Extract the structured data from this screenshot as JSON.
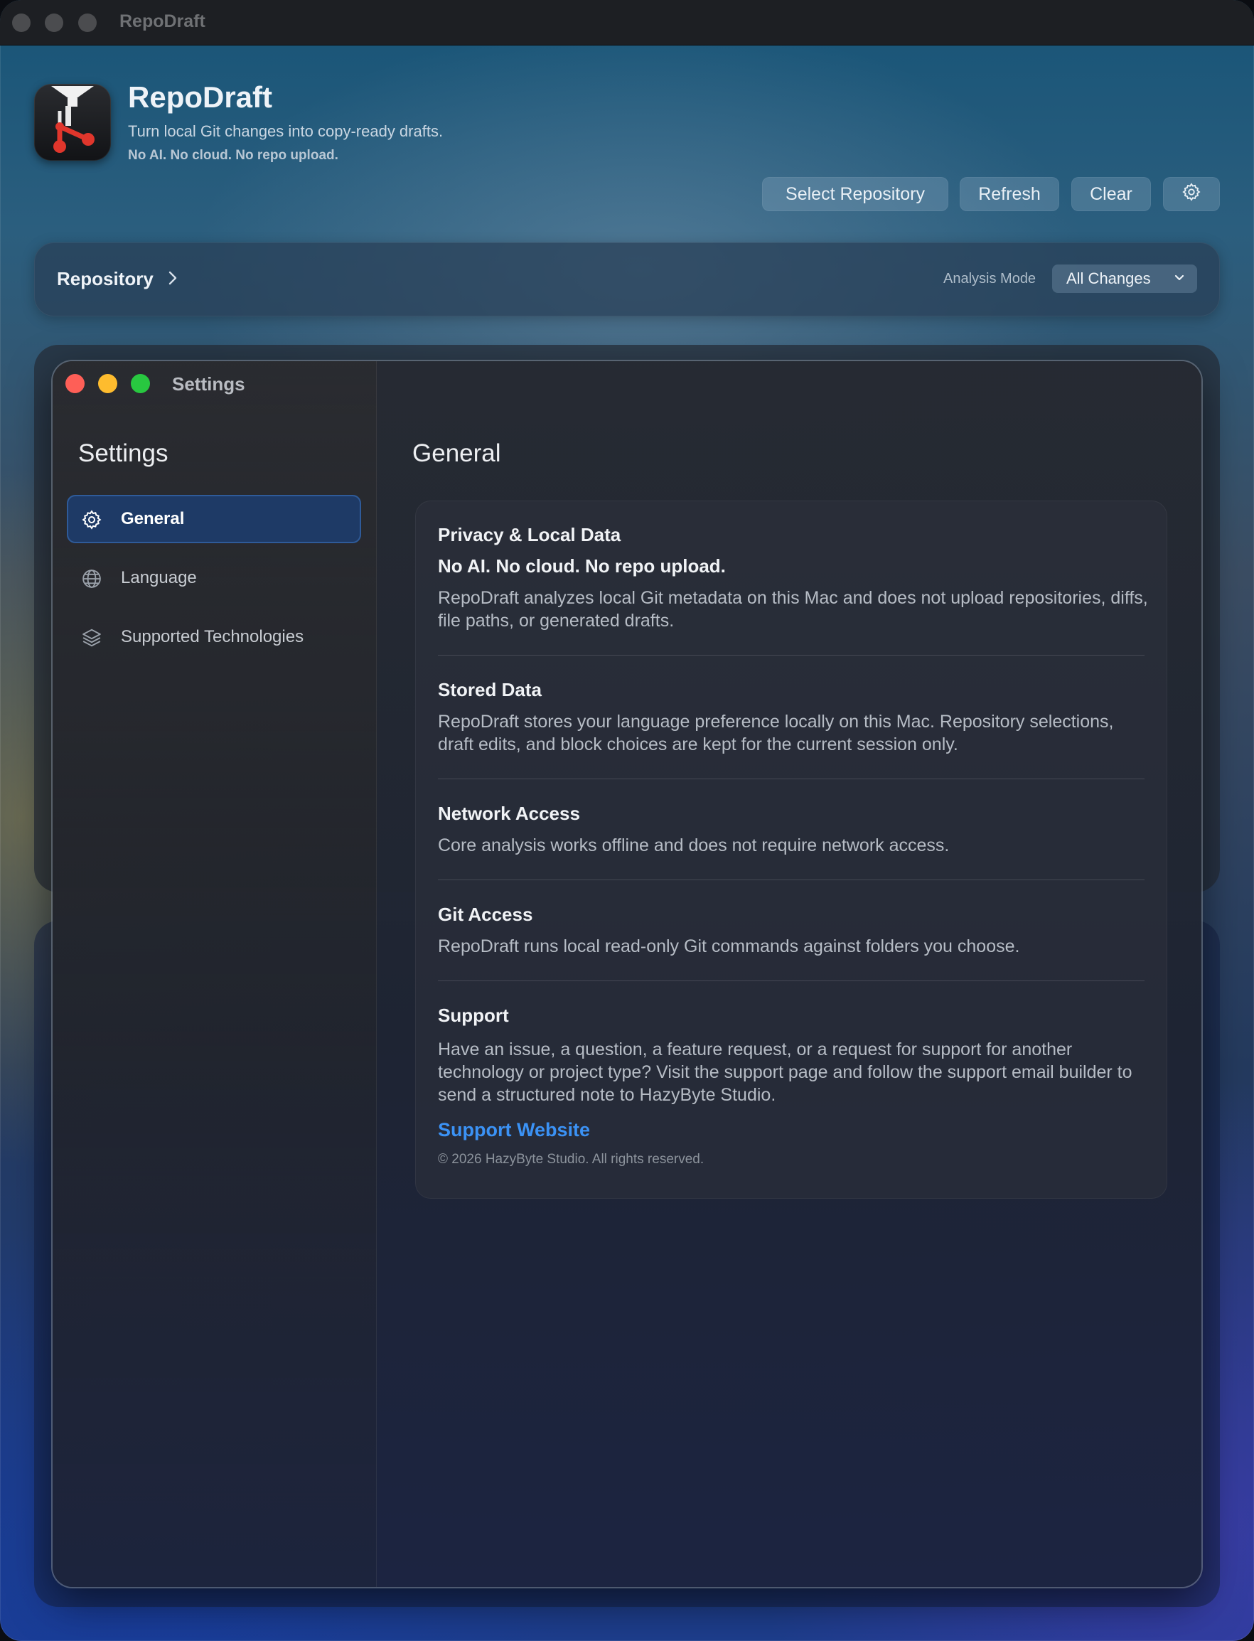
{
  "window": {
    "title": "RepoDraft"
  },
  "header": {
    "app_name": "RepoDraft",
    "subtitle": "Turn local Git changes into copy-ready drafts.",
    "tagline": "No AI. No cloud. No repo upload.",
    "icon": "app-logo-icon"
  },
  "toolbar": {
    "select_repository": "Select Repository",
    "refresh": "Refresh",
    "clear": "Clear",
    "settings_icon": "gear-icon"
  },
  "repository_bar": {
    "label": "Repository",
    "analysis_mode_label": "Analysis Mode",
    "analysis_mode_value": "All Changes"
  },
  "settings": {
    "window_title": "Settings",
    "sidebar_heading": "Settings",
    "sidebar_items": [
      {
        "label": "General",
        "icon": "gear-icon",
        "selected": true
      },
      {
        "label": "Language",
        "icon": "globe-icon",
        "selected": false
      },
      {
        "label": "Supported Technologies",
        "icon": "layers-icon",
        "selected": false
      }
    ],
    "content_heading": "General",
    "sections": {
      "privacy": {
        "title": "Privacy & Local Data",
        "emphasis": "No AI. No cloud. No repo upload.",
        "body": "RepoDraft analyzes local Git metadata on this Mac and does not upload repositories, diffs, file paths, or generated drafts."
      },
      "stored": {
        "title": "Stored Data",
        "body": "RepoDraft stores your language preference locally on this Mac. Repository selections, draft edits, and block choices are kept for the current session only."
      },
      "network": {
        "title": "Network Access",
        "body": "Core analysis works offline and does not require network access."
      },
      "git": {
        "title": "Git Access",
        "body": "RepoDraft runs local read-only Git commands against folders you choose."
      },
      "support": {
        "title": "Support",
        "body": "Have an issue, a question, a feature request, or a request for support for another technology or project type? Visit the support page and follow the support email builder to send a structured note to HazyByte Studio.",
        "link": "Support Website",
        "copyright": "© 2026 HazyByte Studio. All rights reserved."
      }
    }
  },
  "colors": {
    "accent_link": "#3b92f5",
    "selected_item_bg": "#1e3a66",
    "traffic_close": "#fe5f57",
    "traffic_minimize": "#febc2e",
    "traffic_zoom": "#28c840"
  }
}
